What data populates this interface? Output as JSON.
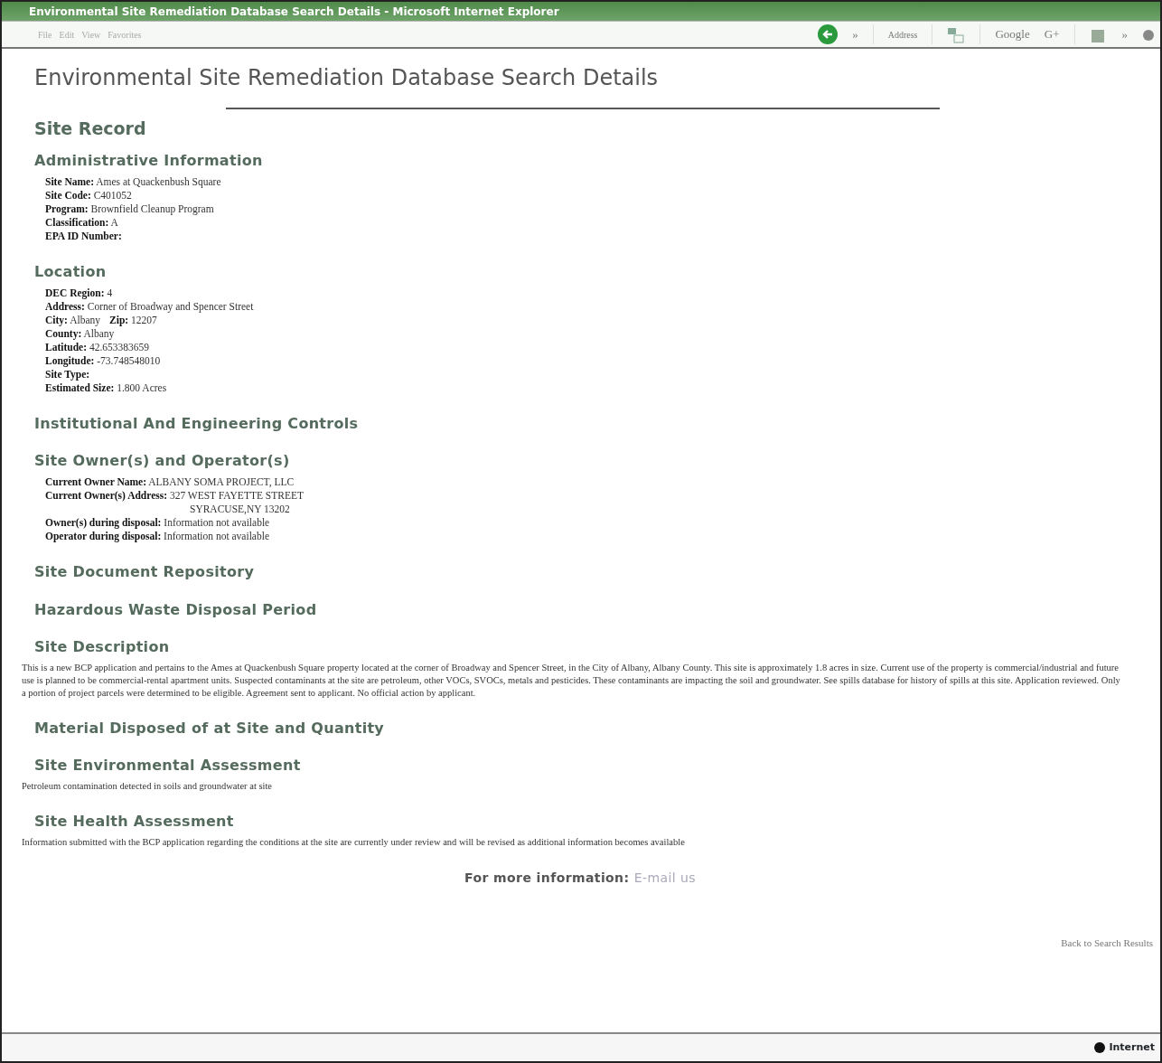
{
  "window": {
    "title": "Environmental Site Remediation Database Search Details - Microsoft Internet Explorer"
  },
  "menu": [
    "File",
    "Edit",
    "View",
    "Favorites"
  ],
  "toolbar": {
    "chevron": "»",
    "address_label": "Address",
    "search_label": "Google",
    "search_button": "G+",
    "more": "»"
  },
  "page": {
    "title": "Environmental Site Remediation Database Search Details",
    "record_heading": "Site Record",
    "sections": [
      {
        "heading": "Administrative Information",
        "lines": [
          {
            "kind": "pairs",
            "pairs": [
              {
                "label": "Site Name:",
                "value": "Ames at Quackenbush Square"
              }
            ]
          },
          {
            "kind": "pairs",
            "pairs": [
              {
                "label": "Site Code:",
                "value": "C401052"
              }
            ]
          },
          {
            "kind": "pairs",
            "pairs": [
              {
                "label": "Program:",
                "value": "Brownfield Cleanup Program"
              }
            ]
          },
          {
            "kind": "pairs",
            "pairs": [
              {
                "label": "Classification:",
                "value": "A"
              }
            ]
          },
          {
            "kind": "pairs",
            "pairs": [
              {
                "label": "EPA ID Number:"
              }
            ]
          }
        ]
      },
      {
        "heading": "Location",
        "lines": [
          {
            "kind": "pairs",
            "pairs": [
              {
                "label": "DEC Region:",
                "value": "4"
              }
            ]
          },
          {
            "kind": "pairs",
            "pairs": [
              {
                "label": "Address:",
                "value": "Corner of Broadway and Spencer Street"
              }
            ]
          },
          {
            "kind": "pairs",
            "pairs": [
              {
                "label": "City:",
                "value": "Albany"
              },
              {
                "label": "Zip:",
                "value": "12207"
              }
            ]
          },
          {
            "kind": "pairs",
            "pairs": [
              {
                "label": "County:",
                "value": "Albany"
              }
            ]
          },
          {
            "kind": "pairs",
            "pairs": [
              {
                "label": "Latitude:",
                "value": "42.653383659"
              }
            ]
          },
          {
            "kind": "pairs",
            "pairs": [
              {
                "label": "Longitude:",
                "value": "-73.748548010"
              }
            ]
          },
          {
            "kind": "pairs",
            "pairs": [
              {
                "label": "Site Type:"
              }
            ]
          },
          {
            "kind": "pairs",
            "pairs": [
              {
                "label": "Estimated Size:",
                "value": "1.800 Acres"
              }
            ]
          }
        ]
      },
      {
        "heading": "Institutional And Engineering Controls"
      },
      {
        "heading": "Site Owner(s) and Operator(s)",
        "lines": [
          {
            "kind": "pairs",
            "pairs": [
              {
                "label": "Current Owner Name:",
                "value": "ALBANY SOMA PROJECT, LLC"
              }
            ]
          },
          {
            "kind": "pairs",
            "pairs": [
              {
                "label": "Current Owner(s) Address:",
                "value": "327 WEST FAYETTE STREET"
              }
            ]
          },
          {
            "kind": "continuation",
            "value": "SYRACUSE,NY 13202"
          },
          {
            "kind": "pairs",
            "pairs": [
              {
                "label": "Owner(s) during disposal:",
                "value": "Information not available"
              }
            ]
          },
          {
            "kind": "pairs",
            "pairs": [
              {
                "label": "Operator during disposal:",
                "value": "Information not available"
              }
            ]
          }
        ]
      },
      {
        "heading": "Site Document Repository"
      },
      {
        "heading": "Hazardous Waste Disposal Period"
      },
      {
        "heading": "Site Description",
        "paragraph": "This is a new BCP application and pertains to the Ames at Quackenbush Square property located at the corner of Broadway and Spencer Street, in the City of Albany, Albany County. This site is approximately 1.8 acres in size. Current use of the property is commercial/industrial and future use is planned to be commercial-rental apartment units. Suspected contaminants at the site are petroleum, other VOCs, SVOCs, metals and pesticides. These contaminants are impacting the soil and groundwater. See spills database for history of spills at this site. Application reviewed. Only a portion of project parcels were determined to be eligible. Agreement sent to applicant. No official action by applicant."
      },
      {
        "heading": "Material Disposed of at Site and Quantity"
      },
      {
        "heading": "Site Environmental Assessment",
        "paragraph": "Petroleum contamination detected in soils and groundwater at site"
      },
      {
        "heading": "Site Health Assessment",
        "paragraph": "Information submitted with the BCP application regarding the conditions at the site are currently under review and will be revised as additional information becomes available"
      }
    ],
    "contact_label": "For more information:",
    "contact_link": "E-mail us",
    "back_link": "Back to Search Results"
  },
  "status_bar": {
    "zone": "Internet"
  }
}
